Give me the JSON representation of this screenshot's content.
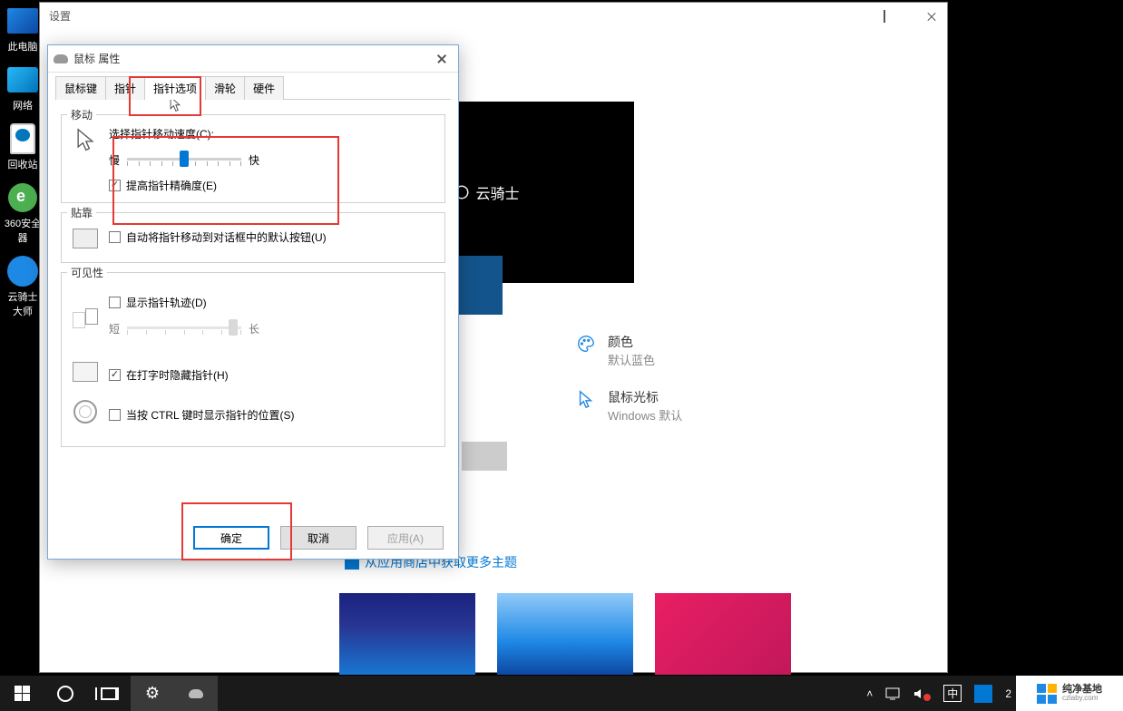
{
  "settings_window": {
    "title": "设置"
  },
  "desktop_icons": {
    "this_pc": "此电脑",
    "network": "网络",
    "recycle_bin": "回收站",
    "security": "360安全\n器",
    "yunqishi": "云骑士\n大师"
  },
  "mouse_dialog": {
    "title": "鼠标 属性",
    "tabs": {
      "buttons": "鼠标键",
      "pointers": "指针",
      "pointer_options": "指针选项",
      "wheel": "滑轮",
      "hardware": "硬件"
    },
    "motion": {
      "group": "移动",
      "speed_label": "选择指针移动速度(C):",
      "slow": "慢",
      "fast": "快",
      "enhance": "提高指针精确度(E)"
    },
    "snap": {
      "group": "贴靠",
      "label": "自动将指针移动到对话框中的默认按钮(U)"
    },
    "visibility": {
      "group": "可见性",
      "trail": "显示指针轨迹(D)",
      "short": "短",
      "long": "长",
      "hide_typing": "在打字时隐藏指针(H)",
      "ctrl_locate": "当按 CTRL 键时显示指针的位置(S)"
    },
    "buttons": {
      "ok": "确定",
      "cancel": "取消",
      "apply": "应用(A)"
    }
  },
  "background": {
    "preview_label": "云骑士",
    "color": {
      "title": "颜色",
      "value": "默认蓝色"
    },
    "cursor": {
      "title": "鼠标光标",
      "value": "Windows 默认"
    },
    "theme_link": "从应用商店中获取更多主题"
  },
  "taskbar": {
    "ime": "中",
    "time_partial": "2"
  },
  "watermark": {
    "name": "纯净基地",
    "url": "czlaby.com"
  }
}
